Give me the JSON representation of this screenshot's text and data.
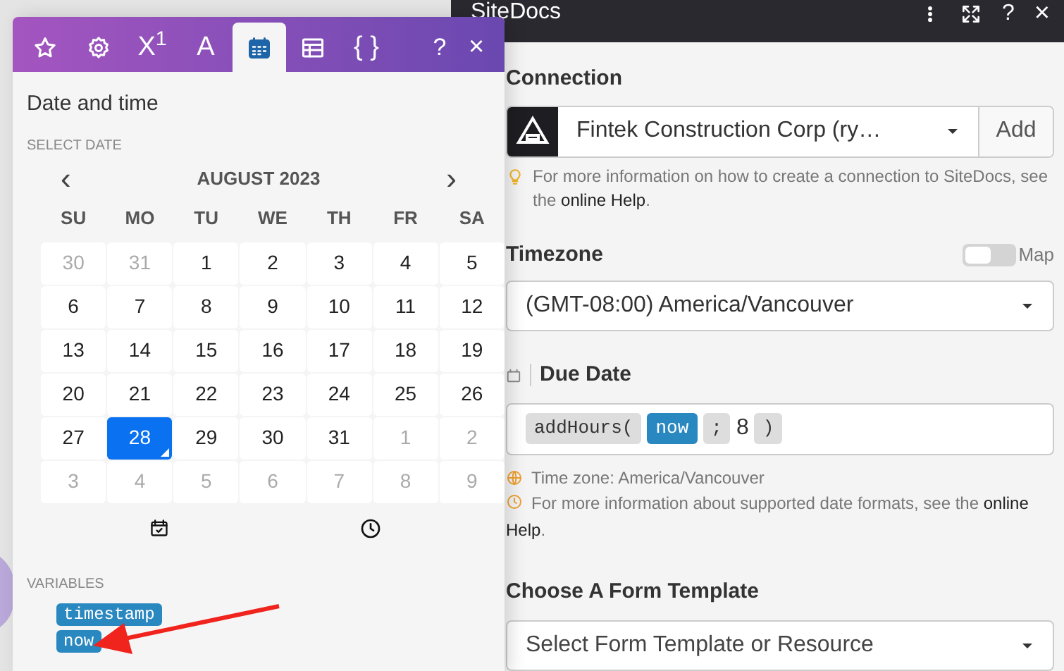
{
  "panel": {
    "title": "SiteDocs",
    "header_help": "?",
    "header_close": "×"
  },
  "popup": {
    "tabs": [
      {
        "kind": "star",
        "selected": false
      },
      {
        "kind": "gear",
        "selected": false
      },
      {
        "kind": "text",
        "label": "X$^{1}$",
        "selected": false
      },
      {
        "kind": "text",
        "label": "A",
        "selected": false
      },
      {
        "kind": "calendar",
        "selected": true
      },
      {
        "kind": "table",
        "selected": false
      },
      {
        "kind": "text",
        "label": "{ }",
        "selected": false
      }
    ],
    "help": "?",
    "close": "×",
    "heading": "Date and time",
    "section": "SELECT DATE",
    "month": "AUGUST 2023",
    "prev": "‹",
    "next": "›",
    "weekdays": [
      "SU",
      "MO",
      "TU",
      "WE",
      "TH",
      "FR",
      "SA"
    ],
    "days": [
      {
        "day": "30",
        "outside": true,
        "selected": false
      },
      {
        "day": "31",
        "outside": true,
        "selected": false
      },
      {
        "day": "1",
        "outside": false,
        "selected": false
      },
      {
        "day": "2",
        "outside": false,
        "selected": false
      },
      {
        "day": "3",
        "outside": false,
        "selected": false
      },
      {
        "day": "4",
        "outside": false,
        "selected": false
      },
      {
        "day": "5",
        "outside": false,
        "selected": false
      },
      {
        "day": "6",
        "outside": false,
        "selected": false
      },
      {
        "day": "7",
        "outside": false,
        "selected": false
      },
      {
        "day": "8",
        "outside": false,
        "selected": false
      },
      {
        "day": "9",
        "outside": false,
        "selected": false
      },
      {
        "day": "10",
        "outside": false,
        "selected": false
      },
      {
        "day": "11",
        "outside": false,
        "selected": false
      },
      {
        "day": "12",
        "outside": false,
        "selected": false
      },
      {
        "day": "13",
        "outside": false,
        "selected": false
      },
      {
        "day": "14",
        "outside": false,
        "selected": false
      },
      {
        "day": "15",
        "outside": false,
        "selected": false
      },
      {
        "day": "16",
        "outside": false,
        "selected": false
      },
      {
        "day": "17",
        "outside": false,
        "selected": false
      },
      {
        "day": "18",
        "outside": false,
        "selected": false
      },
      {
        "day": "19",
        "outside": false,
        "selected": false
      },
      {
        "day": "20",
        "outside": false,
        "selected": false
      },
      {
        "day": "21",
        "outside": false,
        "selected": false
      },
      {
        "day": "22",
        "outside": false,
        "selected": false
      },
      {
        "day": "23",
        "outside": false,
        "selected": false
      },
      {
        "day": "24",
        "outside": false,
        "selected": false
      },
      {
        "day": "25",
        "outside": false,
        "selected": false
      },
      {
        "day": "26",
        "outside": false,
        "selected": false
      },
      {
        "day": "27",
        "outside": false,
        "selected": false
      },
      {
        "day": "28",
        "outside": false,
        "selected": true
      },
      {
        "day": "29",
        "outside": false,
        "selected": false
      },
      {
        "day": "30",
        "outside": false,
        "selected": false
      },
      {
        "day": "31",
        "outside": false,
        "selected": false
      },
      {
        "day": "1",
        "outside": true,
        "selected": false
      },
      {
        "day": "2",
        "outside": true,
        "selected": false
      },
      {
        "day": "3",
        "outside": true,
        "selected": false
      },
      {
        "day": "4",
        "outside": true,
        "selected": false
      },
      {
        "day": "5",
        "outside": true,
        "selected": false
      },
      {
        "day": "6",
        "outside": true,
        "selected": false
      },
      {
        "day": "7",
        "outside": true,
        "selected": false
      },
      {
        "day": "8",
        "outside": true,
        "selected": false
      },
      {
        "day": "9",
        "outside": true,
        "selected": false
      }
    ],
    "variables_label": "VARIABLES",
    "variables": [
      "timestamp",
      "now"
    ]
  },
  "connection": {
    "label": "Connection",
    "value": "Fintek Construction Corp (ry…",
    "add": "Add",
    "hint": "For more information on how to create a connection to SiteDocs, see the",
    "hint_link": "online Help",
    "hint_end": "."
  },
  "timezone": {
    "label": "Timezone",
    "map_label": "Map",
    "map_on": false,
    "value": "(GMT-08:00) America/Vancouver"
  },
  "due_date": {
    "label": "Due Date",
    "tokens": [
      {
        "kind": "function",
        "text": "addHours("
      },
      {
        "kind": "variable",
        "text": "now"
      },
      {
        "kind": "function",
        "text": ";"
      },
      {
        "kind": "plain",
        "text": "8"
      },
      {
        "kind": "function",
        "text": ")"
      }
    ],
    "timezone_note": "Time zone: America/Vancouver",
    "hint": "For more information about supported date formats, see the",
    "hint_link": "online",
    "hint_link2": "Help",
    "hint_end": "."
  },
  "form_template": {
    "label": "Choose A Form Template",
    "placeholder": "Select Form Template or Resource"
  }
}
